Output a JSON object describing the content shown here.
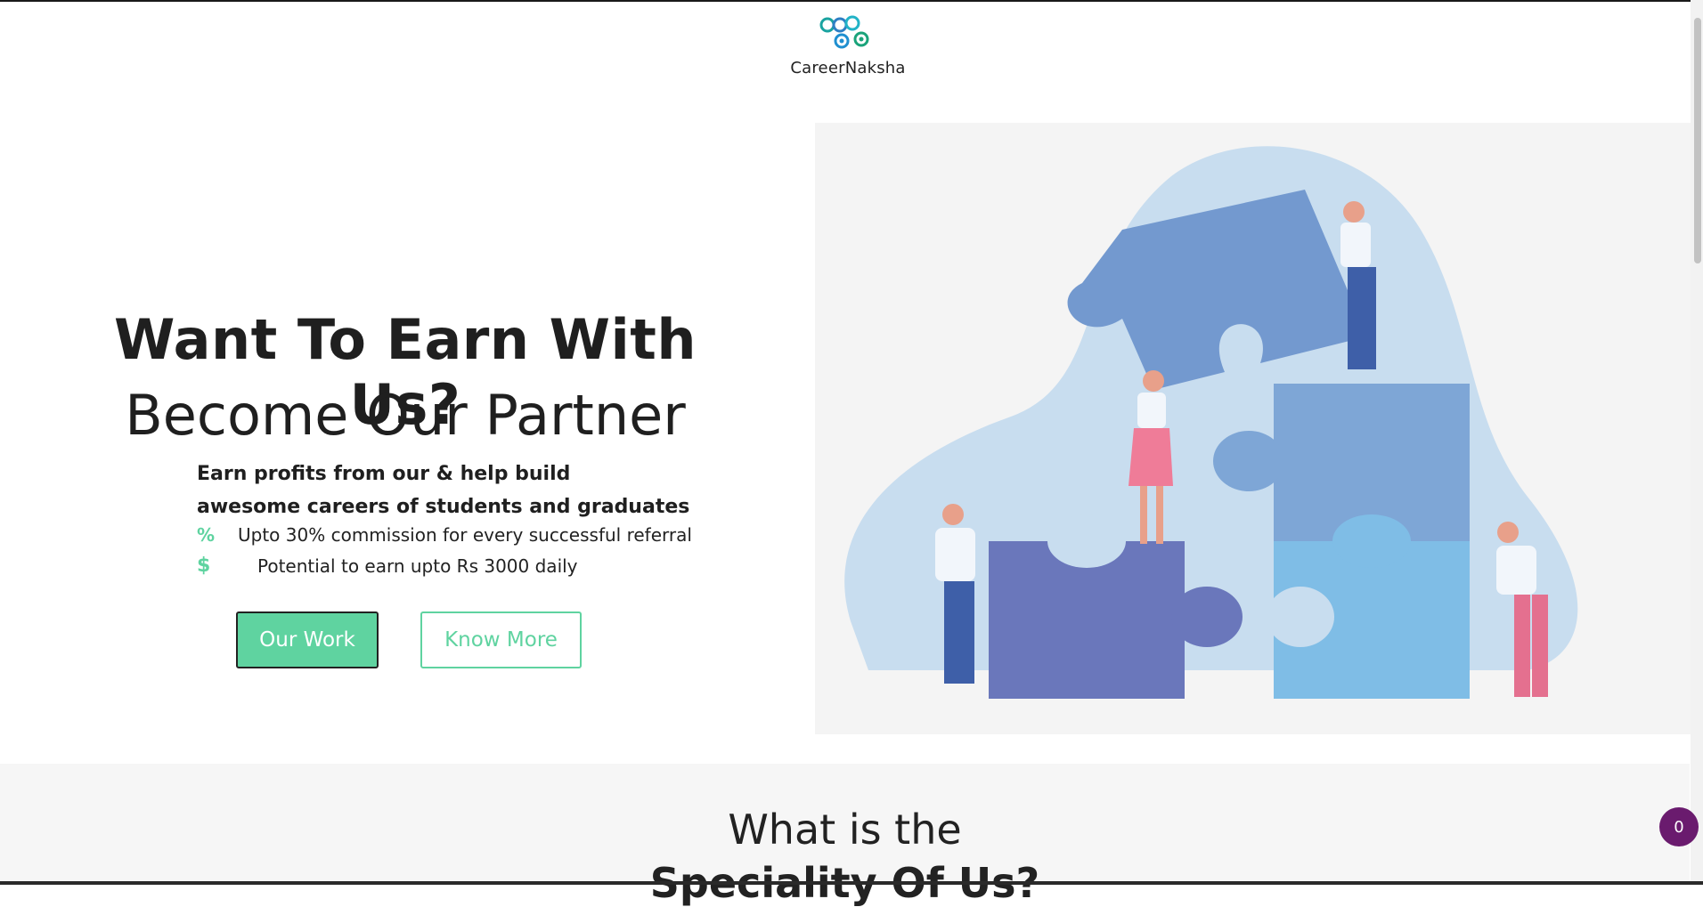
{
  "brand": {
    "name": "CareerNaksha",
    "accent": "#5fd3a0",
    "badge_color": "#6a1b6e"
  },
  "hero": {
    "title": "Want To Earn With Us?",
    "subtitle": "Become Our Partner",
    "description_line1": "Earn profits from our & help build",
    "description_line2": "awesome careers of students and graduates",
    "features": [
      {
        "icon": "percent-icon",
        "glyph": "%",
        "text": "Upto 30% commission for every successful referral"
      },
      {
        "icon": "dollar-icon",
        "glyph": "$",
        "text": "Potential to earn upto Rs 3000 daily"
      }
    ],
    "buttons": {
      "primary": "Our Work",
      "secondary": "Know More"
    }
  },
  "section2": {
    "title_line1": "What is the",
    "title_line2": "Speciality Of Us?"
  },
  "floating_badge": {
    "count": "0"
  }
}
